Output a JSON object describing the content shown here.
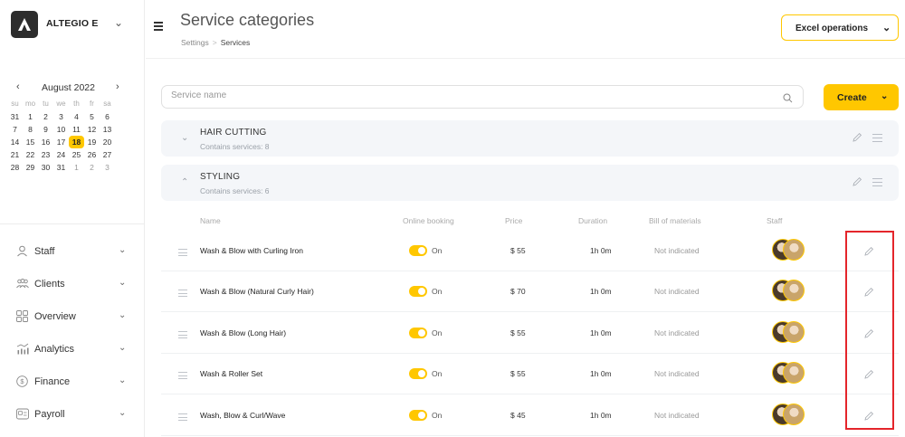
{
  "brand": {
    "name": "ALTEGIO E"
  },
  "calendar": {
    "month_label": "August 2022",
    "prev": "‹",
    "next": "›",
    "days_of_week": [
      "su",
      "mo",
      "tu",
      "we",
      "th",
      "fr",
      "sa"
    ],
    "weeks": [
      [
        "31",
        "1",
        "2",
        "3",
        "4",
        "5",
        "6"
      ],
      [
        "7",
        "8",
        "9",
        "10",
        "11",
        "12",
        "13"
      ],
      [
        "14",
        "15",
        "16",
        "17",
        "18",
        "19",
        "20"
      ],
      [
        "21",
        "22",
        "23",
        "24",
        "25",
        "26",
        "27"
      ],
      [
        "28",
        "29",
        "30",
        "31",
        "1",
        "2",
        "3"
      ]
    ],
    "selected_day": "18"
  },
  "nav": {
    "items": [
      {
        "label": "Staff",
        "icon": "person-icon"
      },
      {
        "label": "Clients",
        "icon": "group-icon"
      },
      {
        "label": "Overview",
        "icon": "grid-icon"
      },
      {
        "label": "Analytics",
        "icon": "analytics-icon"
      },
      {
        "label": "Finance",
        "icon": "dollar-circle-icon"
      },
      {
        "label": "Payroll",
        "icon": "payroll-icon"
      }
    ]
  },
  "header": {
    "title": "Service categories",
    "breadcrumb": [
      "Settings",
      "Services"
    ],
    "breadcrumb_separator": ">",
    "excel_label": "Excel operations"
  },
  "search": {
    "placeholder": "Service name",
    "value": ""
  },
  "create_label": "Create",
  "categories": [
    {
      "name": "HAIR CUTTING",
      "count_text": "Contains services: 8",
      "expanded": false
    },
    {
      "name": "STYLING",
      "count_text": "Contains services: 6",
      "expanded": true
    }
  ],
  "table": {
    "headers": {
      "name": "Name",
      "online_booking": "Online booking",
      "price": "Price",
      "duration": "Duration",
      "bom": "Bill of materials",
      "staff": "Staff"
    },
    "rows": [
      {
        "name": "Wash & Blow with Curling Iron",
        "online": "On",
        "price": "$ 55",
        "duration": "1h 0m",
        "bom": "Not indicated"
      },
      {
        "name": "Wash & Blow (Natural Curly Hair)",
        "online": "On",
        "price": "$ 70",
        "duration": "1h 0m",
        "bom": "Not indicated"
      },
      {
        "name": "Wash & Blow (Long Hair)",
        "online": "On",
        "price": "$ 55",
        "duration": "1h 0m",
        "bom": "Not indicated"
      },
      {
        "name": "Wash & Roller Set",
        "online": "On",
        "price": "$ 55",
        "duration": "1h 0m",
        "bom": "Not indicated"
      },
      {
        "name": "Wash, Blow & Curl/Wave",
        "online": "On",
        "price": "$ 45",
        "duration": "1h 0m",
        "bom": "Not indicated"
      }
    ]
  },
  "colors": {
    "accent": "#ffc700",
    "highlight": "#e4252b",
    "category_bg": "#f4f6f9"
  }
}
